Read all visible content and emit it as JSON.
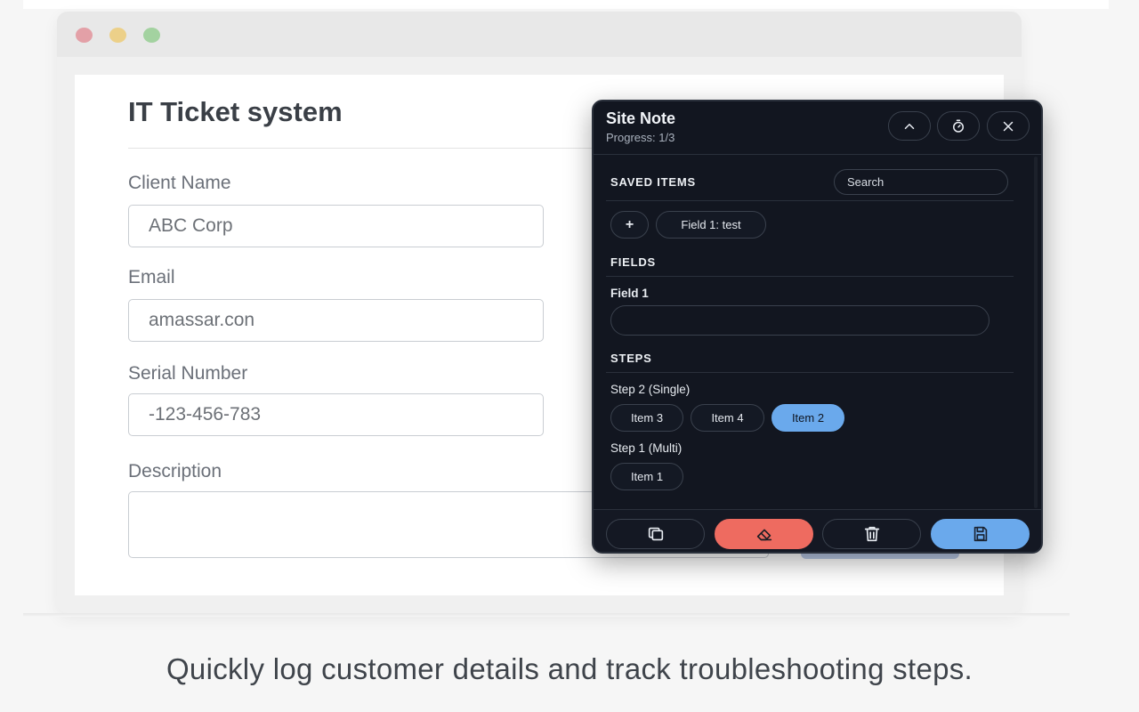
{
  "form": {
    "title": "IT Ticket system",
    "fields": [
      {
        "label": "Client Name",
        "value": "ABC Corp"
      },
      {
        "label": "Email",
        "value": "amassar.con"
      },
      {
        "label": "Serial Number",
        "value": "-123-456-783"
      },
      {
        "label": "Description",
        "value": ""
      }
    ]
  },
  "panel": {
    "title": "Site Note",
    "progress": "Progress: 1/3",
    "header_icons": [
      "chevron-up-icon",
      "timer-icon",
      "close-icon"
    ],
    "saved_items": {
      "heading": "SAVED ITEMS",
      "search_placeholder": "Search",
      "add_label": "+",
      "items": [
        "Field 1: test"
      ]
    },
    "fields": {
      "heading": "FIELDS",
      "field_label": "Field 1",
      "field_value": ""
    },
    "steps": {
      "heading": "STEPS",
      "groups": [
        {
          "label": "Step 2 (Single)",
          "items": [
            "Item 3",
            "Item 4",
            "Item 2"
          ],
          "selected": "Item 2"
        },
        {
          "label": "Step 1 (Multi)",
          "items": [
            "Item 1"
          ]
        }
      ]
    },
    "footer_icons": [
      "copy-icon",
      "eraser-icon",
      "trash-icon",
      "save-icon"
    ],
    "colors": {
      "accent": "#6aa9ec",
      "danger": "#ee6b60",
      "panel_bg": "#121620"
    }
  },
  "caption": "Quickly log customer details and track troubleshooting steps."
}
